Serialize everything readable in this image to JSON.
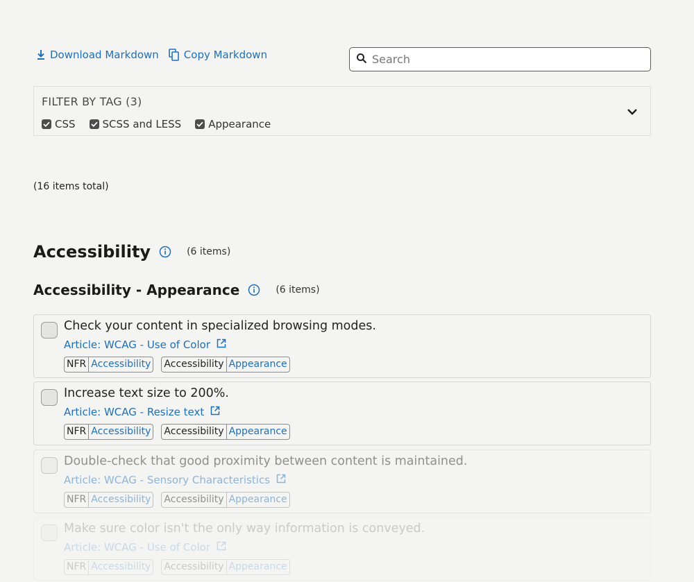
{
  "toolbar": {
    "download_label": "Download Markdown",
    "copy_label": "Copy Markdown"
  },
  "search": {
    "placeholder": "Search",
    "value": ""
  },
  "filter": {
    "title": "FILTER BY TAG (3)",
    "tags": [
      {
        "label": "CSS",
        "checked": true
      },
      {
        "label": "SCSS and LESS",
        "checked": true
      },
      {
        "label": "Appearance",
        "checked": true
      }
    ]
  },
  "total_label": "(16 items total)",
  "section": {
    "title": "Accessibility",
    "count": "(6 items)",
    "subsection": {
      "title": "Accessibility - Appearance",
      "count": "(6 items)",
      "items": [
        {
          "title": "Check your content in specialized browsing modes.",
          "link": "Article: WCAG - Use of Color",
          "tags": [
            {
              "key": "NFR",
              "value": "Accessibility"
            },
            {
              "key": "Accessibility",
              "value": "Appearance"
            }
          ]
        },
        {
          "title": "Increase text size to 200%.",
          "link": "Article: WCAG - Resize text",
          "tags": [
            {
              "key": "NFR",
              "value": "Accessibility"
            },
            {
              "key": "Accessibility",
              "value": "Appearance"
            }
          ]
        },
        {
          "title": "Double-check that good proximity between content is maintained.",
          "link": "Article: WCAG - Sensory Characteristics",
          "tags": [
            {
              "key": "NFR",
              "value": "Accessibility"
            },
            {
              "key": "Accessibility",
              "value": "Appearance"
            }
          ]
        },
        {
          "title": "Make sure color isn't the only way information is conveyed.",
          "link": "Article: WCAG - Use of Color",
          "tags": [
            {
              "key": "NFR",
              "value": "Accessibility"
            },
            {
              "key": "Accessibility",
              "value": "Appearance"
            }
          ]
        }
      ]
    }
  },
  "colors": {
    "link": "#1f6fb8",
    "background": "#f4f4f2",
    "border": "#d6d6d4"
  }
}
